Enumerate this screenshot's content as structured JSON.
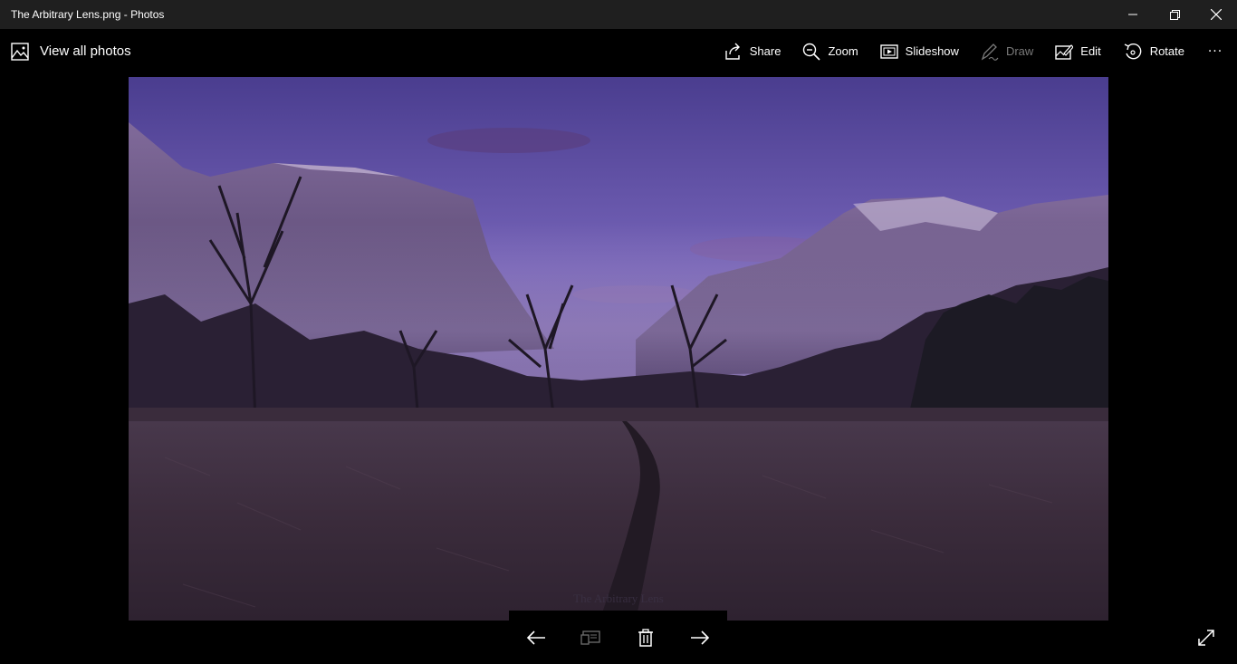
{
  "window": {
    "title": "The Arbitrary Lens.png - Photos"
  },
  "toolbar": {
    "back_label": "View all photos",
    "share_label": "Share",
    "zoom_label": "Zoom",
    "slideshow_label": "Slideshow",
    "draw_label": "Draw",
    "edit_label": "Edit",
    "rotate_label": "Rotate",
    "more_label": "···"
  },
  "photo": {
    "watermark": "The Arbitrary Lens"
  },
  "icons": {
    "back": "photos-app-icon",
    "share": "share-icon",
    "zoom": "zoom-icon",
    "slideshow": "slideshow-icon",
    "draw": "draw-icon",
    "edit": "edit-icon",
    "rotate": "rotate-icon",
    "prev": "arrow-left-icon",
    "compare": "compare-icon",
    "delete": "trash-icon",
    "next": "arrow-right-icon",
    "fullscreen": "expand-icon"
  },
  "colors": {
    "titlebar": "#1f1f1f",
    "background": "#000000",
    "disabled": "#7a7a7a"
  }
}
